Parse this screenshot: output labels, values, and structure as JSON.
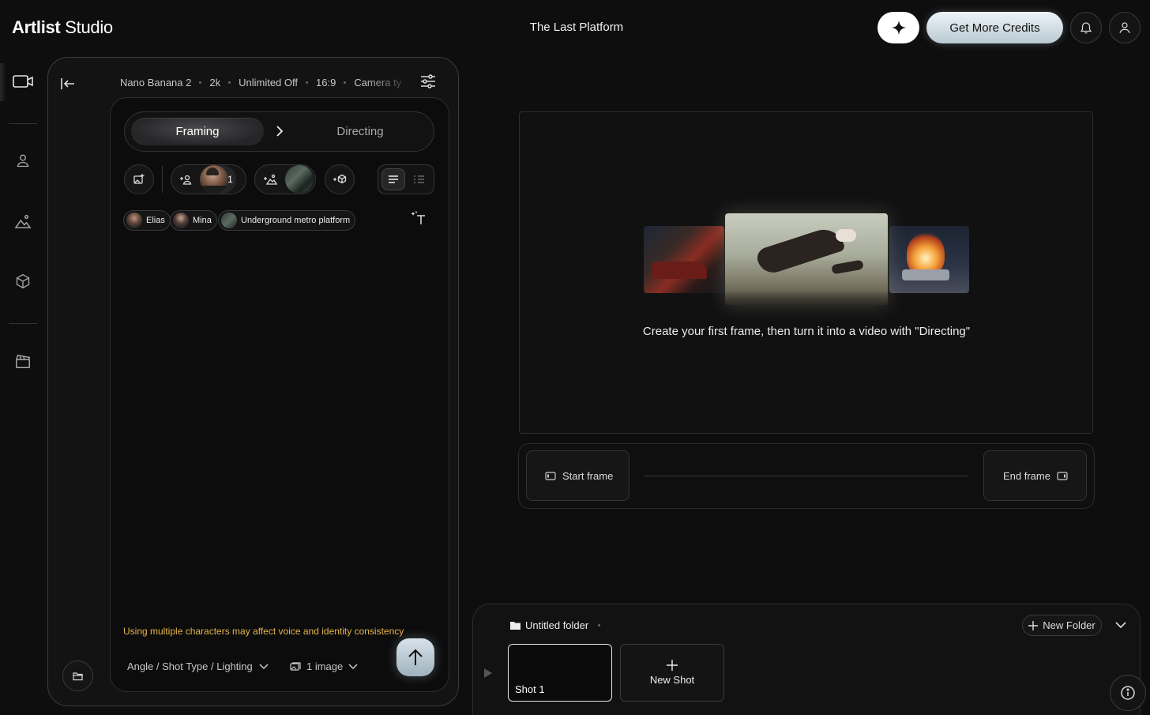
{
  "header": {
    "logo_bold": "Artlist",
    "logo_light": " Studio",
    "project_title": "The Last Platform",
    "credits_label": "Get More Credits"
  },
  "settings": {
    "model": "Nano Banana 2",
    "resolution": "2k",
    "unlimited": "Unlimited Off",
    "aspect": "16:9",
    "camera": "Camera ty"
  },
  "modes": {
    "framing": "Framing",
    "directing": "Directing"
  },
  "characters_extra": "+1",
  "chips": [
    {
      "label": "Elias"
    },
    {
      "label": "Mina"
    },
    {
      "label": "Underground metro platform"
    }
  ],
  "composer": {
    "warning": "Using multiple characters may affect voice and identity consistency",
    "angle_dropdown": "Angle / Shot Type / Lighting",
    "image_dropdown": "1 image"
  },
  "preview": {
    "caption": "Create your first frame, then turn it into a video with \"Directing\""
  },
  "frames": {
    "start": "Start frame",
    "end": "End frame"
  },
  "shots": {
    "folder_name": "Untitled folder",
    "new_folder": "New Folder",
    "items": [
      {
        "label": "Shot 1"
      }
    ],
    "new_shot": "New Shot"
  },
  "colors": {
    "background": "#0e0e0f",
    "accent_credits": "#c9d7df",
    "warning": "#e6b34a"
  },
  "icons": {
    "rail": [
      "video-icon",
      "person-icon",
      "landscape-icon",
      "cube-icon",
      "clapperboard-icon"
    ]
  }
}
